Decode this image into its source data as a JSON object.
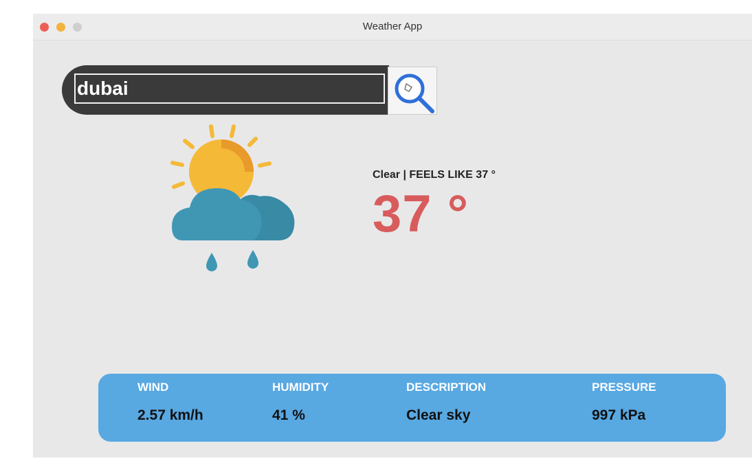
{
  "window": {
    "title": "Weather App"
  },
  "search": {
    "value": "dubai"
  },
  "weather": {
    "icon": "sun-cloud-rain-icon",
    "condition_line": "Clear | FEELS LIKE 37 °",
    "temperature": "37 °",
    "temperature_color": "#d85c5c"
  },
  "stats": [
    {
      "label": "WIND",
      "value": "2.57 km/h"
    },
    {
      "label": "HUMIDITY",
      "value": "41 %"
    },
    {
      "label": "DESCRIPTION",
      "value": "Clear sky"
    },
    {
      "label": "PRESSURE",
      "value": "997 kPa"
    }
  ],
  "colors": {
    "stats_bar": "#58a8e2",
    "search_bar": "#3a3a3a",
    "sun": "#f5b938",
    "cloud": "#3f97b4"
  }
}
